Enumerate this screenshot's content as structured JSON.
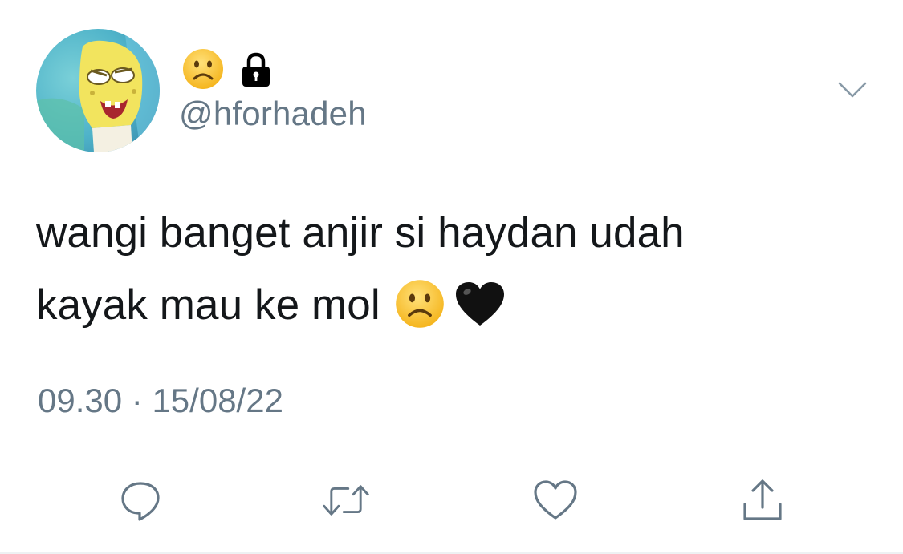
{
  "tweet": {
    "display_name_emoji": [
      "sad-face-emoji",
      "lock-icon"
    ],
    "handle": "@hforhadeh",
    "text_line1": "wangi banget anjir si haydan udah",
    "text_line2": "kayak mau ke mol",
    "text_emoji": [
      "sad-face-emoji",
      "black-heart-emoji"
    ],
    "time": "09.30",
    "separator": "·",
    "date": "15/08/22"
  },
  "actions": [
    "reply-icon",
    "retweet-icon",
    "like-icon",
    "share-icon"
  ],
  "colors": {
    "text": "#14171a",
    "secondary": "#657786",
    "divider": "#e1e8ed",
    "emoji_yellow": "#fbc02d"
  }
}
